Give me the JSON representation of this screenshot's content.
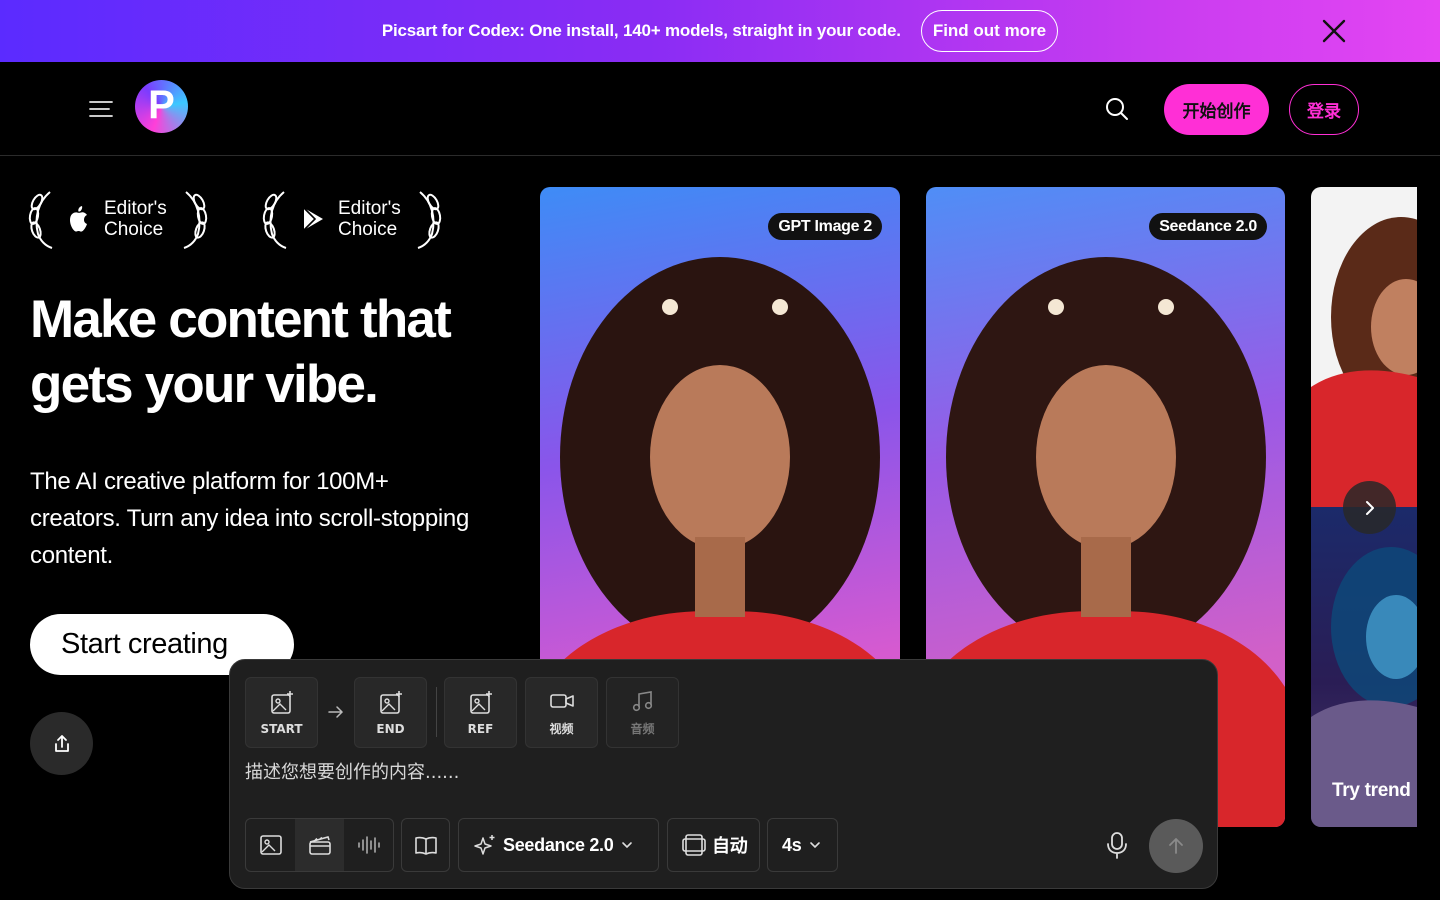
{
  "promo": {
    "text": "Picsart for Codex: One install, 140+ models, straight in your code.",
    "cta": "Find out more"
  },
  "header": {
    "logo_letter": "P",
    "start_button": "开始创作",
    "login_button": "登录"
  },
  "awards": [
    {
      "platform_icon": "apple-icon",
      "label": "Editor's Choice"
    },
    {
      "platform_icon": "google-play-icon",
      "label": "Editor's Choice"
    }
  ],
  "hero": {
    "title": "Make content that gets your vibe.",
    "subtitle": "The AI creative platform for 100M+ creators. Turn any idea into scroll-stopping content.",
    "cta": "Start creating"
  },
  "cards": [
    {
      "badge": "GPT Image 2"
    },
    {
      "badge": "Seedance 2.0"
    },
    {
      "caption": "Try trend"
    }
  ],
  "composer": {
    "tiles": [
      {
        "label": "START",
        "icon": "image-plus-icon"
      },
      {
        "label": "END",
        "icon": "image-plus-icon"
      },
      {
        "label": "REF",
        "icon": "image-plus-icon"
      },
      {
        "label": "视频",
        "icon": "video-icon"
      },
      {
        "label": "音频",
        "icon": "music-note-icon"
      }
    ],
    "prompt_placeholder": "描述您想要创作的内容......",
    "model": "Seedance 2.0",
    "aspect": "自动",
    "duration": "4s"
  },
  "colors": {
    "accent_pink": "#ff2fd6",
    "banner_start": "#5b2bff",
    "banner_end": "#e445f3"
  }
}
